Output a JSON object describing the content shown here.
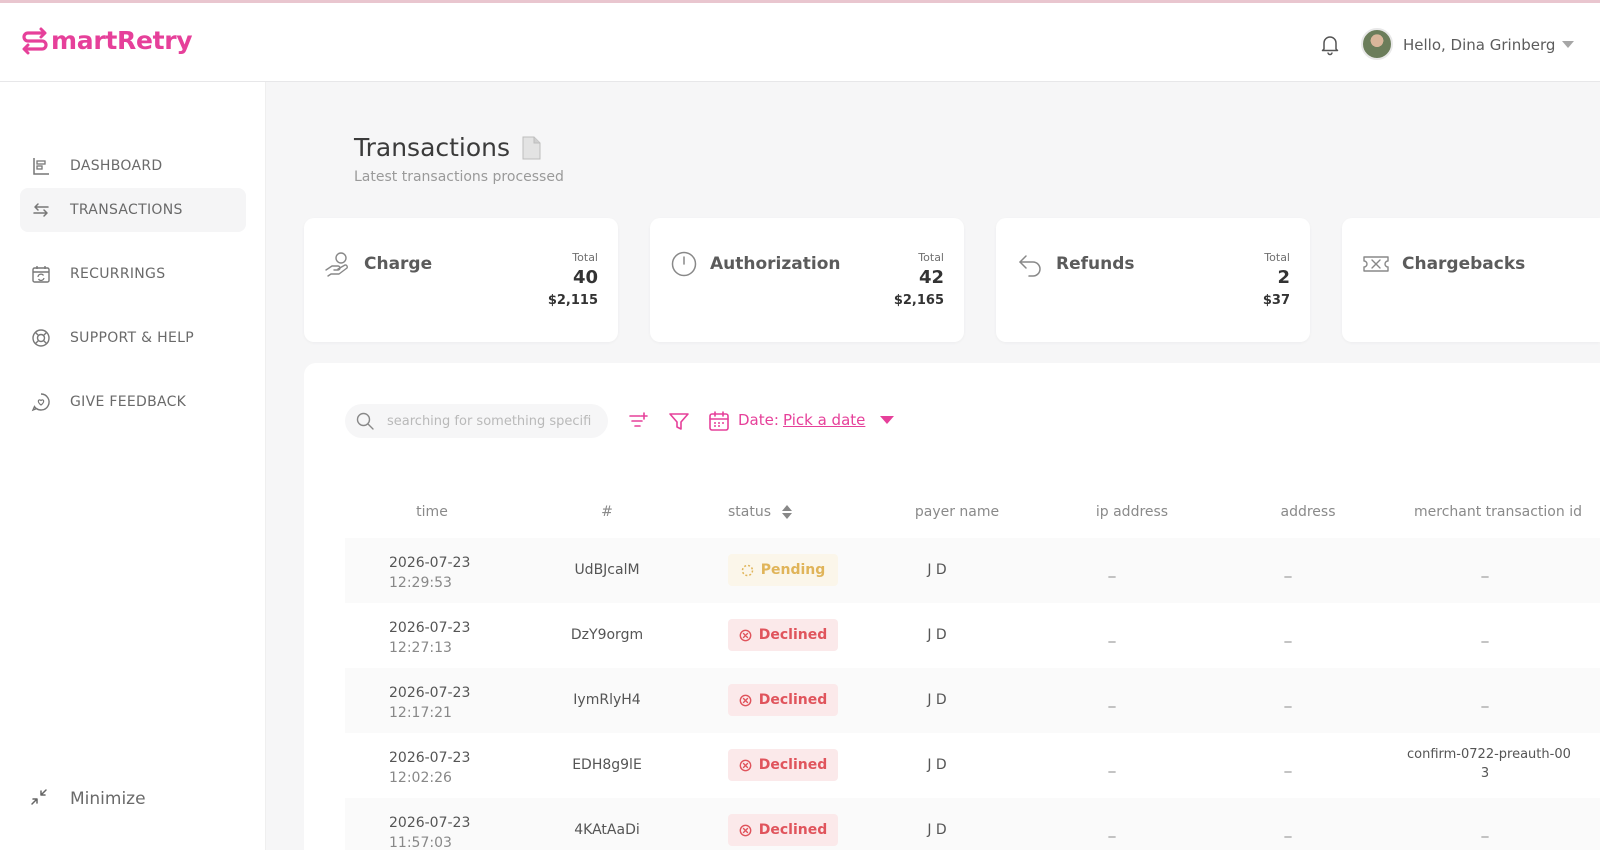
{
  "app": {
    "name_rest": "martRetry"
  },
  "user": {
    "greeting": "Hello, Dina Grinberg"
  },
  "sidebar": {
    "items": [
      {
        "label": "DASHBOARD",
        "icon": "dashboard-icon"
      },
      {
        "label": "TRANSACTIONS",
        "icon": "swap-arrows-icon",
        "active": true
      },
      {
        "label": "RECURRINGS",
        "icon": "calendar-sync-icon"
      },
      {
        "label": "SUPPORT & HELP",
        "icon": "lifebuoy-icon"
      },
      {
        "label": "GIVE FEEDBACK",
        "icon": "feedback-icon"
      }
    ],
    "minimize_label": "Minimize"
  },
  "page": {
    "title": "Transactions",
    "subtitle": "Latest transactions processed"
  },
  "cards": [
    {
      "title": "Charge",
      "total_label": "Total",
      "count": "40",
      "amount": "$2,115"
    },
    {
      "title": "Authorization",
      "total_label": "Total",
      "count": "42",
      "amount": "$2,165"
    },
    {
      "title": "Refunds",
      "total_label": "Total",
      "count": "2",
      "amount": "$37"
    },
    {
      "title": "Chargebacks"
    }
  ],
  "toolbar": {
    "search_placeholder": "searching for something specific?",
    "date_label": "Date:",
    "date_link": "Pick a date"
  },
  "table": {
    "columns": [
      "time",
      "#",
      "status",
      "payer name",
      "ip address",
      "address",
      "merchant transaction id"
    ],
    "rows": [
      {
        "date": "2026-07-23",
        "time": "12:29:53",
        "id": "UdBJcalM",
        "status": "Pending",
        "payer": "J D",
        "ip": "_",
        "address": "_",
        "merchant": "_"
      },
      {
        "date": "2026-07-23",
        "time": "12:27:13",
        "id": "DzY9orgm",
        "status": "Declined",
        "payer": "J D",
        "ip": "_",
        "address": "_",
        "merchant": "_"
      },
      {
        "date": "2026-07-23",
        "time": "12:17:21",
        "id": "IymRlyH4",
        "status": "Declined",
        "payer": "J D",
        "ip": "_",
        "address": "_",
        "merchant": "_"
      },
      {
        "date": "2026-07-23",
        "time": "12:02:26",
        "id": "EDH8g9lE",
        "status": "Declined",
        "payer": "J D",
        "ip": "_",
        "address": "_",
        "merchant": "confirm-0722-preauth-00",
        "merchant2": "3"
      },
      {
        "date": "2026-07-23",
        "time": "11:57:03",
        "id": "4KAtAaDi",
        "status": "Declined",
        "payer": "J D",
        "ip": "_",
        "address": "_",
        "merchant": "_"
      }
    ]
  },
  "colors": {
    "brand": "#e6409a",
    "pending": "#e0b459",
    "declined": "#e0545c"
  }
}
